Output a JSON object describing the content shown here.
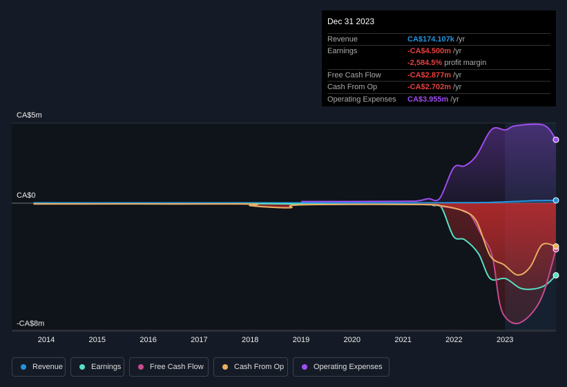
{
  "tooltip": {
    "date": "Dec 31 2023",
    "rows": [
      {
        "label": "Revenue",
        "value": "CA$174.107k",
        "unit": " /yr",
        "color": "#2394df"
      },
      {
        "label": "Earnings",
        "value": "-CA$4.500m",
        "unit": " /yr",
        "color": "#e8403f"
      },
      {
        "label": "",
        "value": "-2,584.5%",
        "unit": " profit margin",
        "color": "#e8403f"
      },
      {
        "label": "Free Cash Flow",
        "value": "-CA$2.877m",
        "unit": " /yr",
        "color": "#e8403f"
      },
      {
        "label": "Cash From Op",
        "value": "-CA$2.702m",
        "unit": " /yr",
        "color": "#e8403f"
      },
      {
        "label": "Operating Expenses",
        "value": "CA$3.955m",
        "unit": " /yr",
        "color": "#a04ef0"
      }
    ]
  },
  "chart_data": {
    "type": "line",
    "ylim": [
      -8,
      5
    ],
    "y_ticks": [
      {
        "v": 5,
        "label": "CA$5m"
      },
      {
        "v": 0,
        "label": "CA$0"
      },
      {
        "v": -8,
        "label": "-CA$8m"
      }
    ],
    "x_ticks": [
      "2014",
      "2015",
      "2016",
      "2017",
      "2018",
      "2019",
      "2020",
      "2021",
      "2022",
      "2023"
    ],
    "highlight_from": 2023,
    "series": [
      {
        "name": "Revenue",
        "color": "#2394df",
        "points": [
          [
            2013.75,
            0.02
          ],
          [
            2018,
            0.02
          ],
          [
            2021,
            0.02
          ],
          [
            2022,
            0.03
          ],
          [
            2022.7,
            0.05
          ],
          [
            2023.3,
            0.12
          ],
          [
            2023.6,
            0.16
          ],
          [
            2024,
            0.174
          ]
        ]
      },
      {
        "name": "Earnings",
        "color": "#58e0c4",
        "points": [
          [
            2013.75,
            -0.03
          ],
          [
            2016,
            -0.05
          ],
          [
            2018,
            -0.03
          ],
          [
            2019,
            -0.05
          ],
          [
            2021.3,
            -0.08
          ],
          [
            2021.6,
            -0.15
          ],
          [
            2021.76,
            -0.3
          ],
          [
            2021.99,
            -2.07
          ],
          [
            2022.21,
            -2.28
          ],
          [
            2022.48,
            -3.15
          ],
          [
            2022.71,
            -4.7
          ],
          [
            2023.01,
            -4.7
          ],
          [
            2023.3,
            -5.3
          ],
          [
            2023.57,
            -5.35
          ],
          [
            2023.8,
            -5.1
          ],
          [
            2024,
            -4.5
          ]
        ]
      },
      {
        "name": "Free Cash Flow",
        "color": "#c84b8f",
        "points": [
          [
            2013.75,
            -0.05
          ],
          [
            2017.8,
            -0.05
          ],
          [
            2018,
            -0.15
          ],
          [
            2018.4,
            -0.25
          ],
          [
            2018.8,
            -0.28
          ],
          [
            2019,
            -0.1
          ],
          [
            2021.3,
            -0.08
          ],
          [
            2021.76,
            -0.2
          ],
          [
            2022.1,
            -0.4
          ],
          [
            2022.31,
            -0.69
          ],
          [
            2022.54,
            -1.98
          ],
          [
            2022.75,
            -3.28
          ],
          [
            2022.89,
            -6.16
          ],
          [
            2023.02,
            -7.16
          ],
          [
            2023.25,
            -7.5
          ],
          [
            2023.53,
            -6.85
          ],
          [
            2023.76,
            -5.56
          ],
          [
            2024,
            -2.877
          ]
        ]
      },
      {
        "name": "Cash From Op",
        "color": "#e8b060",
        "points": [
          [
            2013.75,
            -0.05
          ],
          [
            2017.8,
            -0.05
          ],
          [
            2018,
            -0.15
          ],
          [
            2018.4,
            -0.25
          ],
          [
            2018.8,
            -0.28
          ],
          [
            2019,
            -0.1
          ],
          [
            2021.3,
            -0.08
          ],
          [
            2021.76,
            -0.17
          ],
          [
            2022.17,
            -0.47
          ],
          [
            2022.44,
            -1.12
          ],
          [
            2022.71,
            -3.28
          ],
          [
            2022.98,
            -3.84
          ],
          [
            2023.25,
            -4.48
          ],
          [
            2023.49,
            -4.0
          ],
          [
            2023.73,
            -2.59
          ],
          [
            2024,
            -2.702
          ]
        ]
      },
      {
        "name": "Operating Expenses",
        "color": "#a04ef0",
        "points": [
          [
            2019,
            0.1
          ],
          [
            2021,
            0.12
          ],
          [
            2021.3,
            0.15
          ],
          [
            2021.5,
            0.28
          ],
          [
            2021.72,
            0.3
          ],
          [
            2021.99,
            2.2
          ],
          [
            2022.21,
            2.33
          ],
          [
            2022.44,
            2.97
          ],
          [
            2022.74,
            4.6
          ],
          [
            2023.01,
            4.57
          ],
          [
            2023.21,
            4.83
          ],
          [
            2023.76,
            4.87
          ],
          [
            2024,
            3.955
          ]
        ]
      }
    ]
  },
  "legend": [
    {
      "label": "Revenue",
      "color": "#2394df"
    },
    {
      "label": "Earnings",
      "color": "#58e0c4"
    },
    {
      "label": "Free Cash Flow",
      "color": "#c84b8f"
    },
    {
      "label": "Cash From Op",
      "color": "#e8b060"
    },
    {
      "label": "Operating Expenses",
      "color": "#a04ef0"
    }
  ]
}
